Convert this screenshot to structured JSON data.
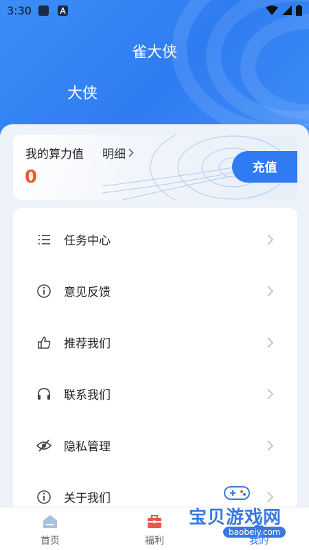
{
  "status_bar": {
    "time": "3:30"
  },
  "header": {
    "app_title": "雀大侠",
    "username": "大侠"
  },
  "points_card": {
    "label": "我的算力值",
    "detail_label": "明细",
    "value": "0",
    "recharge_label": "充值"
  },
  "menu": {
    "items": [
      {
        "label": "任务中心",
        "icon": "list-icon"
      },
      {
        "label": "意见反馈",
        "icon": "info-icon"
      },
      {
        "label": "推荐我们",
        "icon": "thumbs-up-icon"
      },
      {
        "label": "联系我们",
        "icon": "headset-icon"
      },
      {
        "label": "隐私管理",
        "icon": "eye-off-icon"
      },
      {
        "label": "关于我们",
        "icon": "info-icon"
      }
    ]
  },
  "tabbar": {
    "tabs": [
      {
        "label": "首页",
        "icon": "home-icon"
      },
      {
        "label": "福利",
        "icon": "toolbox-icon"
      },
      {
        "label": "我的",
        "icon": "profile-icon"
      }
    ]
  },
  "watermark": {
    "text": "宝贝游戏网",
    "url": "baobeiy.com"
  },
  "colors": {
    "primary": "#2f7cf2",
    "points_value": "#f05a28",
    "toolbox": "#e8564a"
  }
}
